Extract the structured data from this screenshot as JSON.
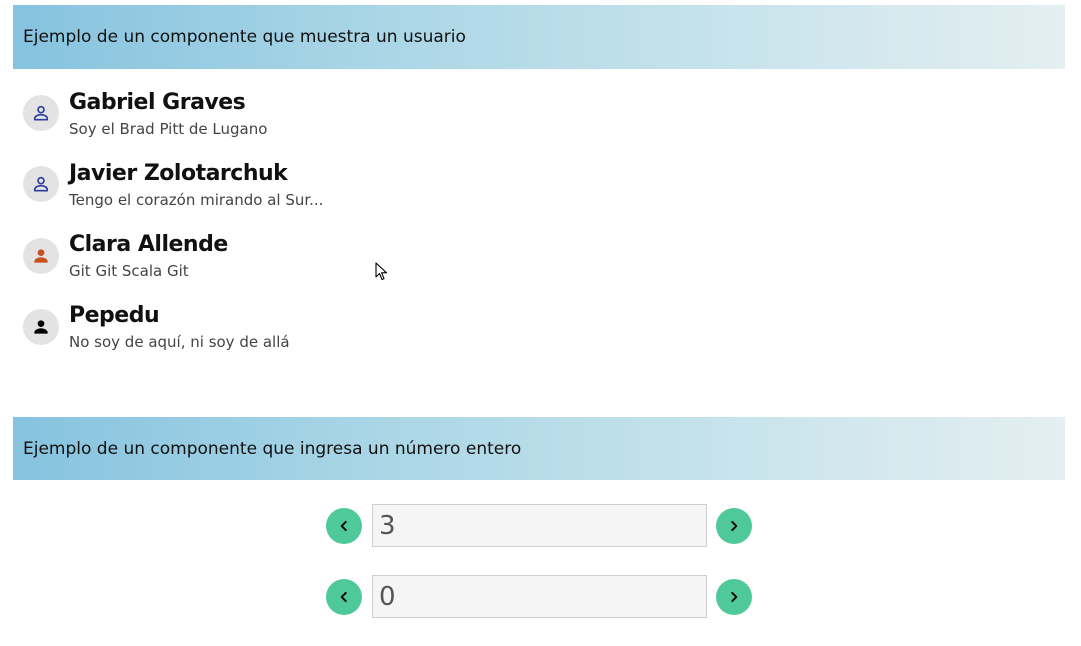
{
  "sections": {
    "users_title": "Ejemplo de un componente que muestra un usuario",
    "number_title": "Ejemplo de un componente que ingresa un número entero"
  },
  "users": [
    {
      "name": "Gabriel Graves",
      "description": "Soy el Brad Pitt de Lugano",
      "icon": "person-outline-icon",
      "icon_color": "#2f3e9e"
    },
    {
      "name": "Javier Zolotarchuk",
      "description": "Tengo el corazón mirando al Sur...",
      "icon": "person-outline-icon",
      "icon_color": "#2f3e9e"
    },
    {
      "name": "Clara Allende",
      "description": "Git Git Scala Git",
      "icon": "person-filled-icon",
      "icon_color": "#c8501e"
    },
    {
      "name": "Pepedu",
      "description": "No soy de aquí, ni soy de allá",
      "icon": "person-filled-icon",
      "icon_color": "#000000"
    }
  ],
  "steppers": [
    {
      "value": "3"
    },
    {
      "value": "0"
    }
  ],
  "colors": {
    "header_gradient_start": "#86c3df",
    "header_gradient_end": "#e4eff1",
    "stepper_button": "#4fc99a",
    "avatar_bg": "#e3e3e3"
  }
}
